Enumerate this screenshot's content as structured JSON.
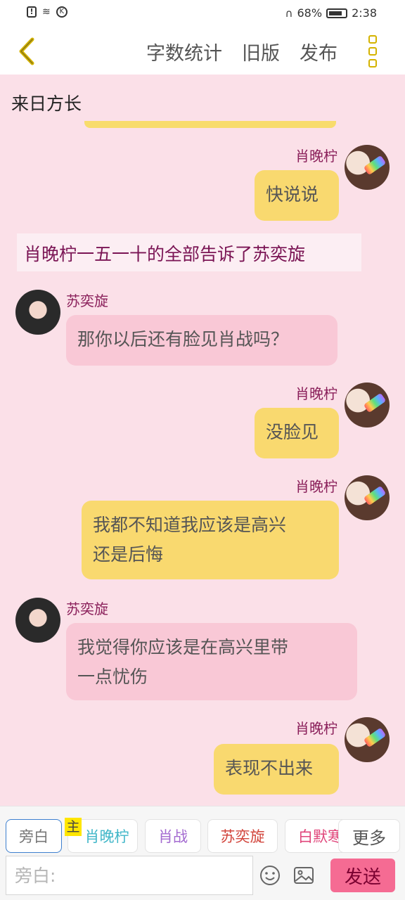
{
  "status_bar": {
    "battery": "68%",
    "time": "2:38"
  },
  "nav": {
    "actions": [
      "字数统计",
      "旧版",
      "发布"
    ]
  },
  "story": {
    "title": "来日方长"
  },
  "messages": [
    {
      "sender": "肖晚柠",
      "text": "快说说",
      "side": "right"
    },
    {
      "type": "narration",
      "text": "肖晚柠一五一十的全部告诉了苏奕旋"
    },
    {
      "sender": "苏奕旋",
      "text": "那你以后还有脸见肖战吗？",
      "side": "left"
    },
    {
      "sender": "肖晚柠",
      "text": "没脸见",
      "side": "right"
    },
    {
      "sender": "肖晚柠",
      "text": "我都不知道我应该是高兴还是后悔",
      "line1": "我都不知道我应该是高兴",
      "line2": "还是后悔",
      "side": "right"
    },
    {
      "sender": "苏奕旋",
      "text": "我觉得你应该是在高兴里带一点忧伤",
      "line1": "我觉得你应该是在高兴里带",
      "line2": "一点忧伤",
      "side": "left"
    },
    {
      "sender": "肖晚柠",
      "text": "表现不出来",
      "side": "right"
    }
  ],
  "roles": {
    "main_badge": "主",
    "items": [
      {
        "label": "旁白",
        "color": "#777777"
      },
      {
        "label": "肖晚柠",
        "color": "#3fb6c8"
      },
      {
        "label": "肖战",
        "color": "#a36ad0"
      },
      {
        "label": "苏奕旋",
        "color": "#d2453c"
      },
      {
        "label": "白默寒",
        "color": "#e0457a"
      }
    ],
    "more": "更多"
  },
  "composer": {
    "placeholder": "旁白:",
    "send": "发送"
  },
  "colors": {
    "accent": "#d4b300",
    "send": "#f56b93",
    "yellow_bubble": "#f9d96f",
    "pink_bubble": "#f9c8d6",
    "background": "#fbe0e8"
  },
  "icons": [
    "back-chevron-icon",
    "more-vertical-icon",
    "emoji-icon",
    "image-icon",
    "alarm-icon",
    "wifi-icon",
    "headphone-icon",
    "battery-icon"
  ]
}
